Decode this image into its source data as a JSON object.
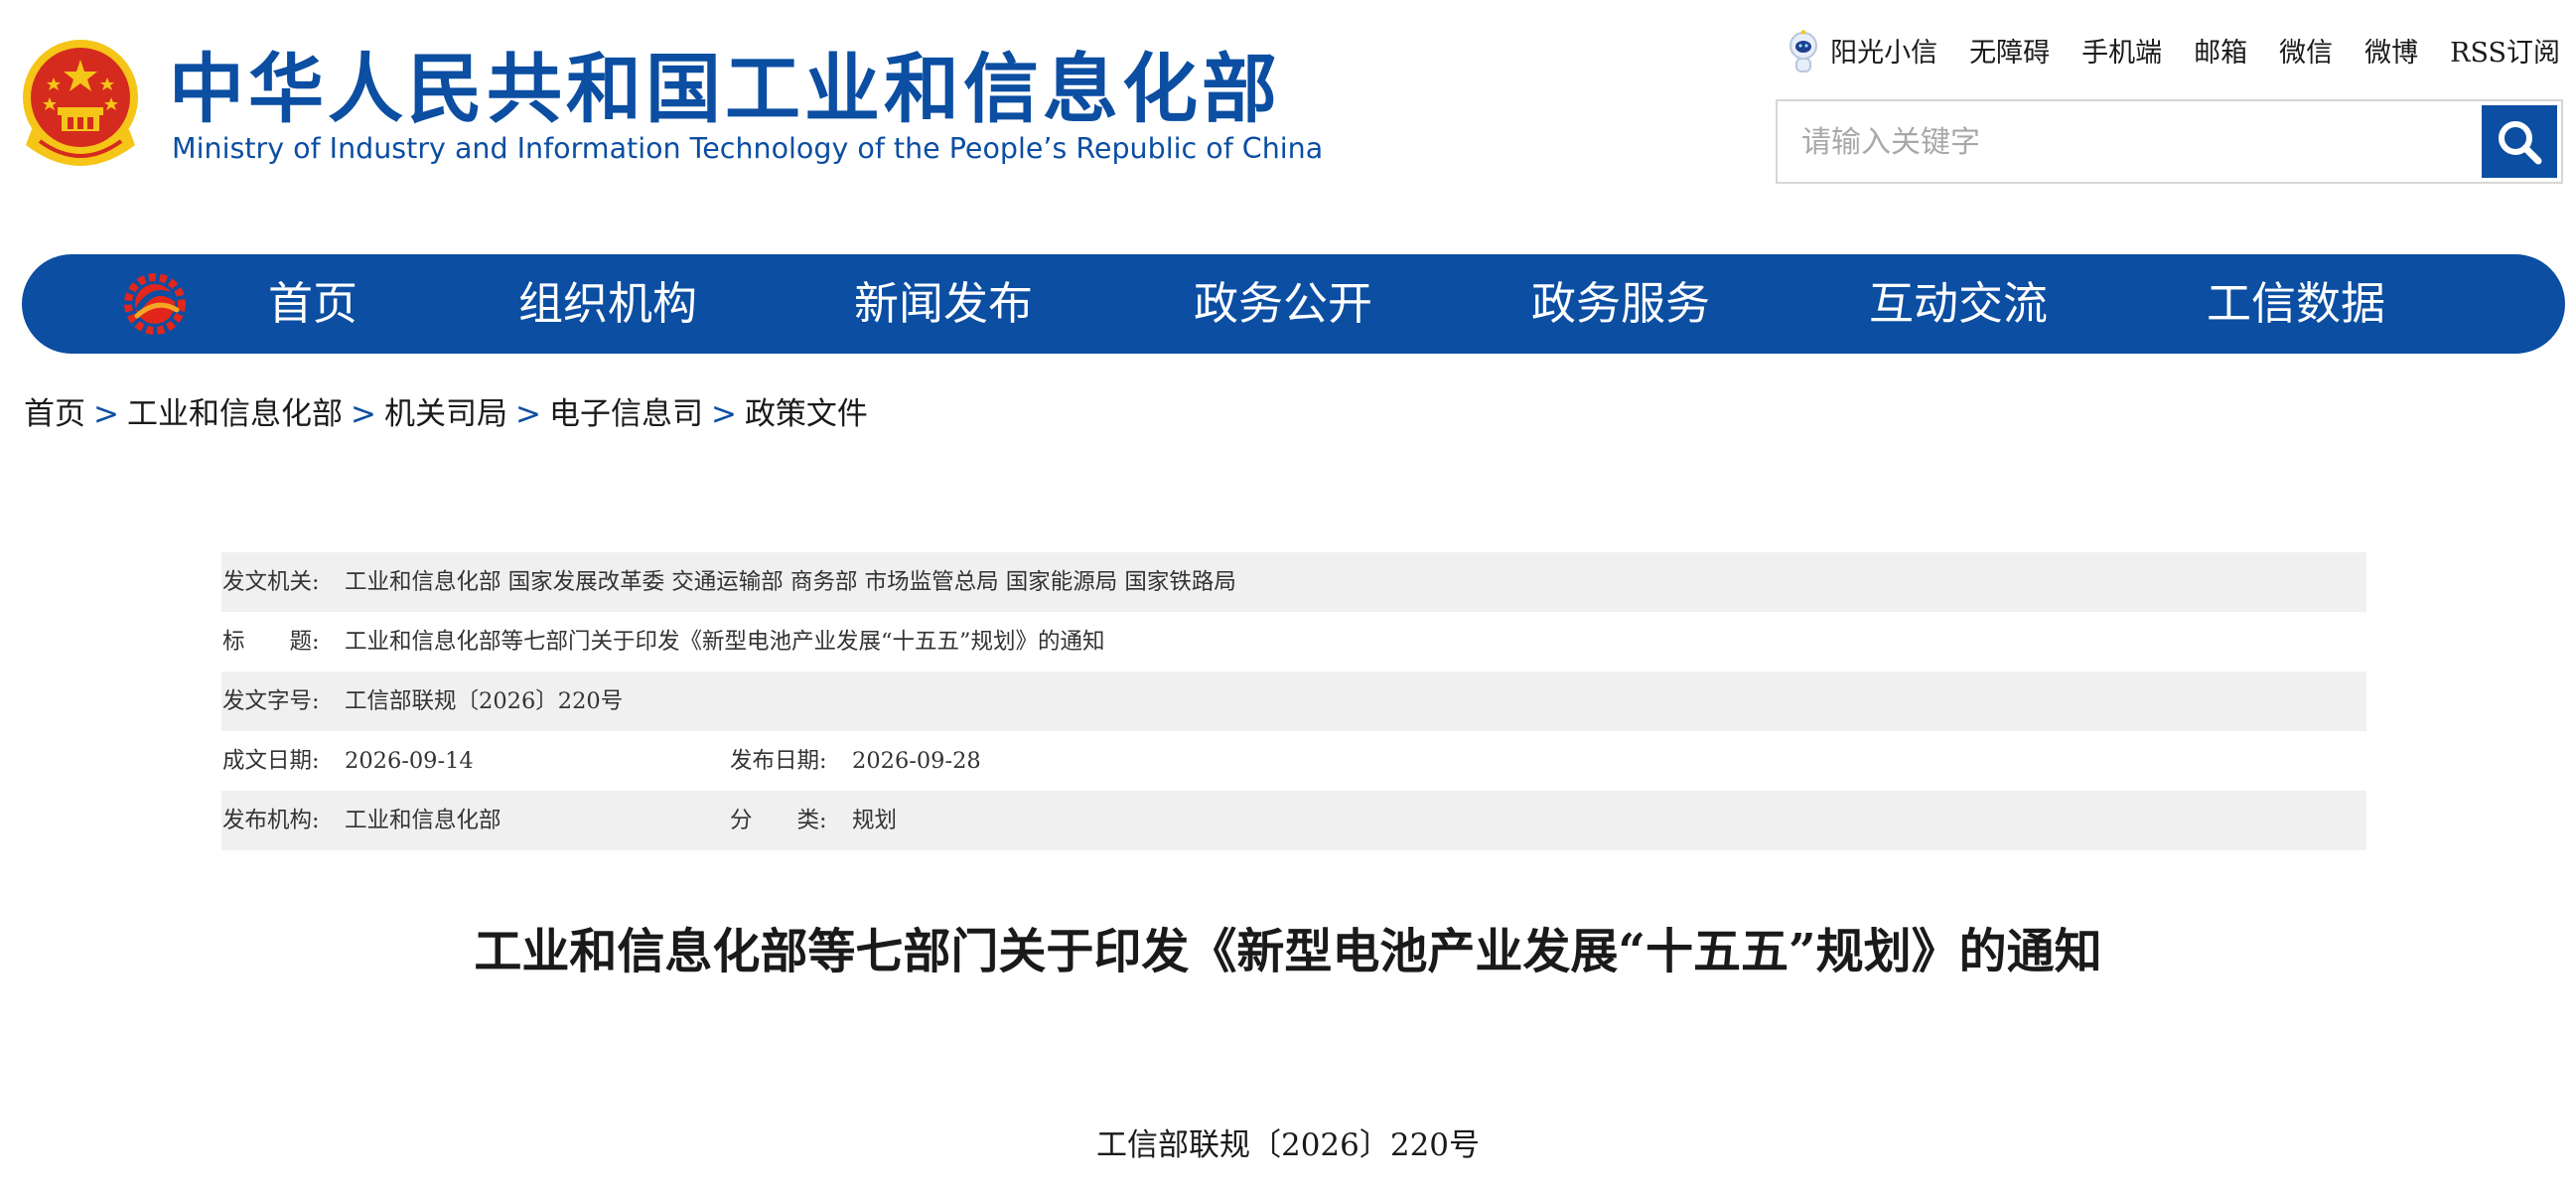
{
  "header": {
    "site_title_cn": "中华人民共和国工业和信息化部",
    "site_title_en": "Ministry of Industry and Information Technology of the People’s Republic of China",
    "top_links": [
      "阳光小信",
      "无障碍",
      "手机端",
      "邮箱",
      "微信",
      "微博",
      "RSS订阅"
    ],
    "search_placeholder": "请输入关键字",
    "search_icon": "search-icon"
  },
  "nav": {
    "items": [
      "首页",
      "组织机构",
      "新闻发布",
      "政务公开",
      "政务服务",
      "互动交流",
      "工信数据"
    ]
  },
  "breadcrumb": {
    "items": [
      "首页",
      "工业和信息化部",
      "机关司局",
      "电子信息司",
      "政策文件"
    ],
    "separator": ">"
  },
  "info": {
    "issuer_label": "发文机关:",
    "issuer_value": "工业和信息化部 国家发展改革委 交通运输部 商务部 市场监管总局 国家能源局 国家铁路局",
    "title_label": "标　　题:",
    "title_value": "工业和信息化部等七部门关于印发《新型电池产业发展“十五五”规划》的通知",
    "doc_no_label": "发文字号:",
    "doc_no_value": "工信部联规〔2026〕220号",
    "written_date_label": "成文日期:",
    "written_date_value": "2026-09-14",
    "publish_date_label": "发布日期:",
    "publish_date_value": "2026-09-28",
    "publisher_label": "发布机构:",
    "publisher_value": "工业和信息化部",
    "category_label": "分　　类:",
    "category_value": "规划"
  },
  "document": {
    "title": "工业和信息化部等七部门关于印发《新型电池产业发展“十五五”规划》的通知",
    "number": "工信部联规〔2026〕220号"
  },
  "colors": {
    "brand_blue": "#0b4ea2",
    "row_shade": "#f0f0f0",
    "emblem_red": "#d52b1e",
    "emblem_gold": "#f5c518"
  }
}
